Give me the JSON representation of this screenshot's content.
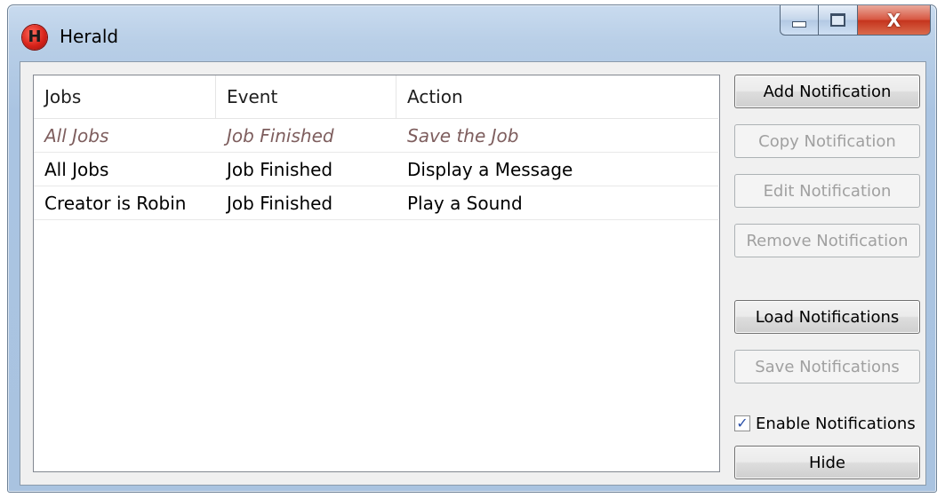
{
  "window": {
    "title": "Herald",
    "icon": "herald-icon",
    "icon_letter": "H",
    "caption_buttons": {
      "minimize": "minimize-icon",
      "maximize": "maximize-icon",
      "close": "close-icon",
      "close_glyph": "X"
    }
  },
  "table": {
    "columns": [
      "Jobs",
      "Event",
      "Action"
    ],
    "rows": [
      {
        "jobs": "All Jobs",
        "event": "Job Finished",
        "action": "Save the Job",
        "enabled": false
      },
      {
        "jobs": "All Jobs",
        "event": "Job Finished",
        "action": "Display a Message",
        "enabled": true
      },
      {
        "jobs": "Creator is Robin",
        "event": "Job Finished",
        "action": "Play a Sound",
        "enabled": true
      }
    ]
  },
  "buttons": {
    "add": {
      "label": "Add Notification",
      "enabled": true
    },
    "copy": {
      "label": "Copy Notification",
      "enabled": false
    },
    "edit": {
      "label": "Edit Notification",
      "enabled": false
    },
    "remove": {
      "label": "Remove Notification",
      "enabled": false
    },
    "load": {
      "label": "Load Notifications",
      "enabled": true
    },
    "save": {
      "label": "Save Notifications",
      "enabled": false
    },
    "hide": {
      "label": "Hide",
      "enabled": true
    }
  },
  "enable_notifications": {
    "label": "Enable Notifications",
    "checked": true
  }
}
